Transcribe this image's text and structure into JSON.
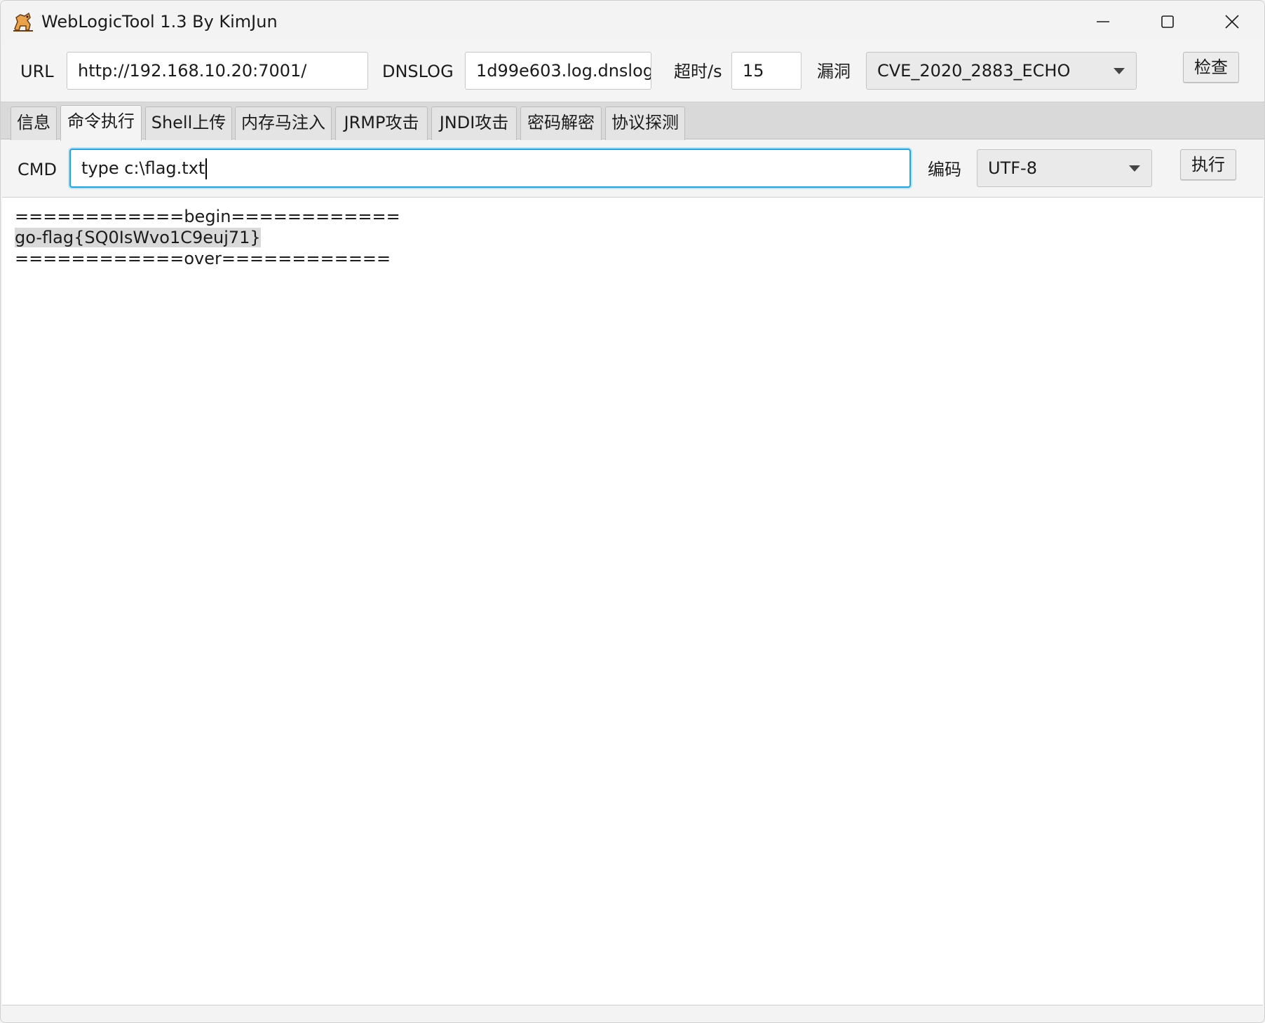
{
  "window": {
    "title": "WebLogicTool 1.3 By KimJun"
  },
  "toolbar": {
    "url_label": "URL",
    "url_value": "http://192.168.10.20:7001/",
    "dnslog_label": "DNSLOG",
    "dnslog_value": "1d99e603.log.dnslog",
    "timeout_label": "超时/s",
    "timeout_value": "15",
    "vuln_label": "漏洞",
    "vuln_selected": "CVE_2020_2883_ECHO",
    "check_button": "检查"
  },
  "tabs": [
    {
      "label": "信息"
    },
    {
      "label": "命令执行"
    },
    {
      "label": "Shell上传"
    },
    {
      "label": "内存马注入"
    },
    {
      "label": "JRMP攻击"
    },
    {
      "label": "JNDI攻击"
    },
    {
      "label": "密码解密"
    },
    {
      "label": "协议探测"
    }
  ],
  "active_tab": "命令执行",
  "command": {
    "cmd_label": "CMD",
    "cmd_value": "type c:\\flag.txt",
    "encoding_label": "编码",
    "encoding_selected": "UTF-8",
    "execute_button": "执行"
  },
  "output": {
    "lines": [
      "============begin============",
      "go-flag{SQ0IsWvo1C9euj71}",
      "============over============"
    ]
  },
  "colors": {
    "focus_border": "#1ea5e6",
    "selection": "#d9d9d9"
  }
}
